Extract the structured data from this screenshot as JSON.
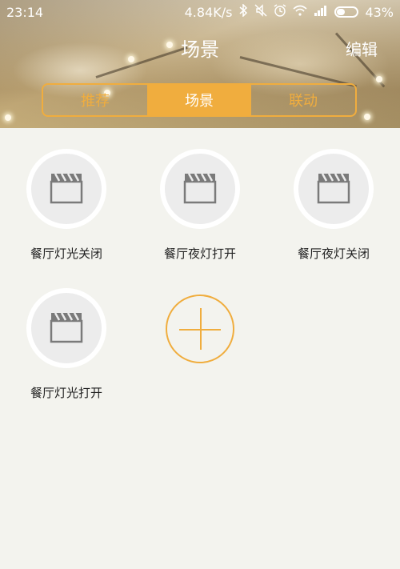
{
  "status_bar": {
    "time": "23:14",
    "network_speed": "4.84K/s",
    "battery": "43%",
    "battery_level": 0.43,
    "icons": [
      "bluetooth-icon",
      "mute-icon",
      "alarm-icon",
      "wifi-icon",
      "signal-icon",
      "battery-icon"
    ]
  },
  "header": {
    "title": "场景",
    "edit_label": "编辑"
  },
  "tabs": [
    {
      "label": "推荐",
      "active": false
    },
    {
      "label": "场景",
      "active": true
    },
    {
      "label": "联动",
      "active": false
    }
  ],
  "scenes": [
    {
      "label": "餐厅灯光关闭",
      "icon": "clapperboard-icon"
    },
    {
      "label": "餐厅夜灯打开",
      "icon": "clapperboard-icon"
    },
    {
      "label": "餐厅夜灯关闭",
      "icon": "clapperboard-icon"
    },
    {
      "label": "餐厅灯光打开",
      "icon": "clapperboard-icon"
    }
  ],
  "add_button": {
    "icon": "plus-icon"
  },
  "colors": {
    "accent": "#f0ad3e",
    "background": "#f3f3ee",
    "icon_gray": "#7a7a7a"
  }
}
